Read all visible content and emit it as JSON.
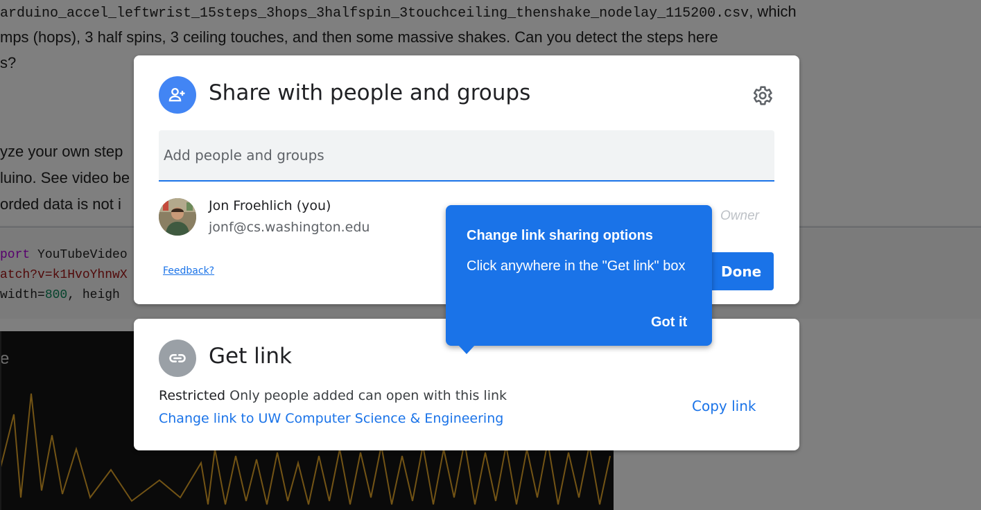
{
  "background": {
    "lines": [
      {
        "pre": "",
        "code": "arduino_accel_leftwrist_15steps_3hops_3halfspin_3touchceiling_thenshake_nodelay_115200.csv",
        "post": ", which"
      },
      {
        "pre": "mps (hops), 3 half spins, 3 ceiling touches, and then some massive shakes. Can you detect the steps here",
        "code": "",
        "post": ""
      },
      {
        "pre": "s?",
        "code": "",
        "post": ""
      },
      {
        "pre": "yze your own step",
        "code": "",
        "post": ""
      },
      {
        "pre": "luino. See video be",
        "code": "",
        "post": ""
      },
      {
        "pre": "orded data is not i",
        "code": "",
        "post": ""
      }
    ],
    "code_lines": {
      "line1_kw": "port",
      "line1_rest": " YouTubeVideo",
      "line2": "atch?v=k1HvoYhnwX",
      "line3_pre": " width=",
      "line3_num": "800",
      "line3_post": ", heigh"
    },
    "video_label": "e"
  },
  "share": {
    "title": "Share with people and groups",
    "icon": "person-add-icon",
    "settings_icon": "gear-icon",
    "input_placeholder": "Add people and groups",
    "person": {
      "name": "Jon Froehlich (you)",
      "email": "jonf@cs.washington.edu",
      "role": "Owner"
    },
    "feedback_label": "Feedback?",
    "done_label": "Done"
  },
  "link": {
    "title": "Get link",
    "icon": "link-icon",
    "restricted_label": "Restricted",
    "restricted_desc": "Only people added can open with this link",
    "change_label": "Change link to UW Computer Science & Engineering",
    "copy_label": "Copy link"
  },
  "tooltip": {
    "title": "Change link sharing options",
    "body": "Click anywhere in the \"Get link\" box",
    "button": "Got it"
  },
  "colors": {
    "accent": "#1a73e8",
    "share_icon_bg": "#4285f4",
    "link_icon_bg": "#9aa0a6"
  }
}
